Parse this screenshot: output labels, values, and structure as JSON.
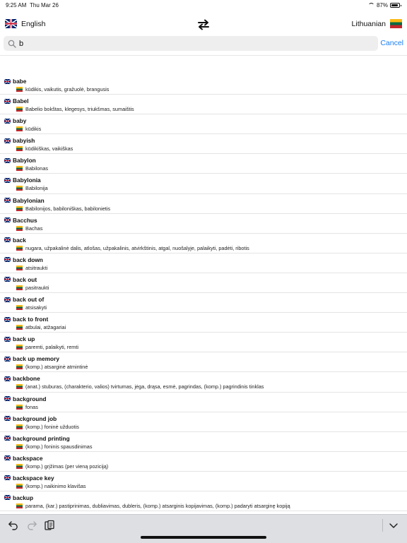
{
  "status": {
    "time": "9:25 AM",
    "date": "Thu Mar 26",
    "battery": "87%",
    "battery_level": 0.87
  },
  "languages": {
    "source": "English",
    "target": "Lithuanian",
    "swap_icon": "swap-arrows-icon"
  },
  "search": {
    "value": "b",
    "cancel_label": "Cancel",
    "icon": "magnifier-icon"
  },
  "entries": [
    {
      "term": "babe",
      "translation": "kūdikis, vaikutis, gražuolė, brangusis"
    },
    {
      "term": "Babel",
      "translation": "Babelio bokštas, klegesys, triukšmas, sumaištis"
    },
    {
      "term": "baby",
      "translation": "kūdikis"
    },
    {
      "term": "babyish",
      "translation": "kūdikiškas, vaikiškas"
    },
    {
      "term": "Babylon",
      "translation": "Babilonas"
    },
    {
      "term": "Babylonia",
      "translation": "Babilonija"
    },
    {
      "term": "Babylonian",
      "translation": "Babilonijos, babiloniškas, babilonietis"
    },
    {
      "term": "Bacchus",
      "translation": "Bachas"
    },
    {
      "term": "back",
      "translation": "nugara, užpakalinė dalis, atlošas, užpakalinis, atvirkštinis, atgal, nuošalyje, palaikyti, padėti, ribotis"
    },
    {
      "term": "back down",
      "translation": "atsitraukti"
    },
    {
      "term": "back out",
      "translation": "pasitraukti"
    },
    {
      "term": "back out of",
      "translation": "atsisakyti"
    },
    {
      "term": "back to front",
      "translation": "atbulai, atžagariai"
    },
    {
      "term": "back up",
      "translation": "paremti, palaikyti, remti"
    },
    {
      "term": "back up memory",
      "translation": "(komp.) atsarginė atmintinė"
    },
    {
      "term": "backbone",
      "translation": "(anat.) stuburas, (charakterio, valios) tvirtumas, jėga, drąsa, esmė, pagrindas, (komp.) pagrindinis tinklas"
    },
    {
      "term": "background",
      "translation": "fonas"
    },
    {
      "term": "background job",
      "translation": "(komp.) foninė užduotis"
    },
    {
      "term": "background printing",
      "translation": "(komp.) foninis spausdinimas"
    },
    {
      "term": "backspace",
      "translation": "(komp.) grįžimas (per vieną poziciją)"
    },
    {
      "term": "backspace key",
      "translation": "(komp.) naikinimo klavišas"
    },
    {
      "term": "backup",
      "translation": "parama, (kar.) pastiprinimas, dubliavimas, dubleris, (komp.) atsarginis kopijavimas, (komp.) padaryti atsarginę kopiją"
    }
  ],
  "toolbar": {
    "undo_icon": "undo-icon",
    "redo_icon": "redo-icon",
    "paste_icon": "paste-icon",
    "dismiss_icon": "chevron-down-icon"
  },
  "colors": {
    "accent": "#1b7ef5",
    "toolbar_bg": "#dedfe2"
  }
}
